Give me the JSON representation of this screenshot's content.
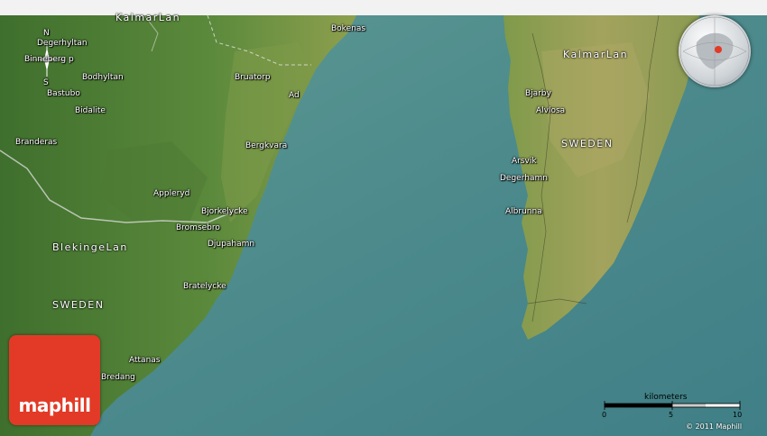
{
  "brand": {
    "name": "maphill",
    "color": "#e23a26"
  },
  "copyright": "© 2011 Maphill",
  "scale": {
    "title": "kilometers",
    "ticks": [
      "0",
      "5",
      "10"
    ]
  },
  "compass": {
    "north": "N",
    "south": "S"
  },
  "regions": {
    "kalmarlan_top": "KalmarLan",
    "kalmarlan_island": "KalmarLan",
    "sweden_island": "SWEDEN",
    "blekingelan": "BlekingeLan",
    "sweden_main": "SWEDEN"
  },
  "places": {
    "bokenas": "Bokenas",
    "degerhyltan": "Degerhyltan",
    "binnebergsp": "Binneberg p",
    "bodhyltan": "Bodhyltan",
    "bastubo": "Bastubo",
    "bidalite": "Bidalite",
    "bruatorp": "Bruatorp",
    "ad": "Ad",
    "branderas": "Branderas",
    "bergkvara": "Bergkvara",
    "appleryd": "Appleryd",
    "bjorkelycke": "Bjorkelycke",
    "bromsebro": "Bromsebro",
    "djupahamn": "Djupahamn",
    "bratelycke": "Bratelycke",
    "attanas": "Attanas",
    "bredang": "Bredang",
    "bjarby": "Bjarby",
    "alvlosa": "Alvlosa",
    "arsvik": "Arsvik",
    "degerhamn": "Degerhamn",
    "albrunna": "Albrunna"
  },
  "colors": {
    "sea": "#4f8f8e",
    "land_forest": "#4f7c36",
    "land_open": "#a5a656"
  }
}
